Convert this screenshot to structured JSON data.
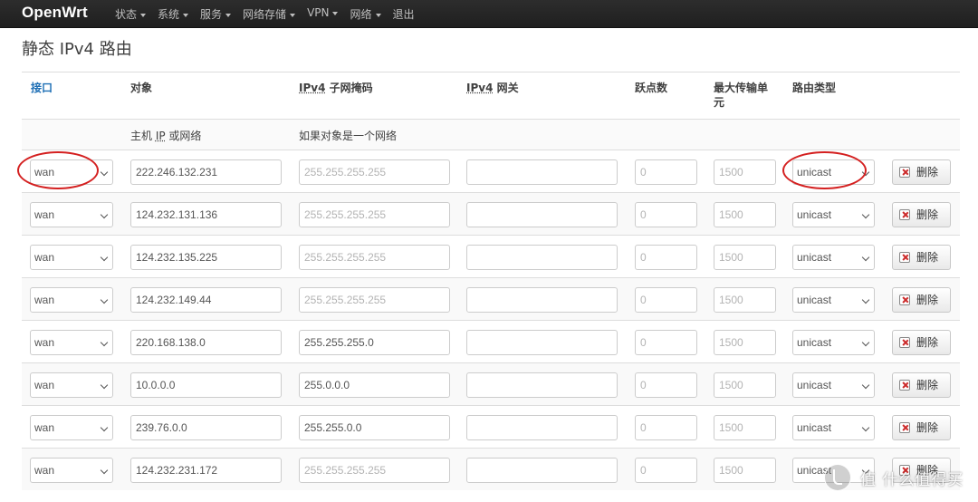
{
  "navbar": {
    "brand": "OpenWrt",
    "menu": [
      {
        "label": "状态",
        "dropdown": true
      },
      {
        "label": "系统",
        "dropdown": true
      },
      {
        "label": "服务",
        "dropdown": true
      },
      {
        "label": "网络存储",
        "dropdown": true
      },
      {
        "label": "VPN",
        "dropdown": true
      },
      {
        "label": "网络",
        "dropdown": true
      },
      {
        "label": "退出",
        "dropdown": false
      }
    ]
  },
  "page": {
    "title": "静态 IPv4 路由"
  },
  "table": {
    "headers": {
      "interface": "接口",
      "target": "对象",
      "netmask_abbr": "IPv4",
      "netmask_rest": " 子网掩码",
      "gateway_abbr": "IPv4",
      "gateway_rest": " 网关",
      "metric": "跃点数",
      "mtu": "最大传输单元",
      "type": "路由类型"
    },
    "descriptions": {
      "target_pre": "主机 ",
      "target_abbr": "IP",
      "target_post": " 或网络",
      "netmask": "如果对象是一个网络"
    },
    "placeholders": {
      "netmask": "255.255.255.255",
      "gateway": "",
      "metric": "0",
      "mtu": "1500"
    },
    "delete_label": "删除",
    "rows": [
      {
        "interface": "wan",
        "target": "222.246.132.231",
        "netmask": "",
        "gateway": "",
        "type": "unicast"
      },
      {
        "interface": "wan",
        "target": "124.232.131.136",
        "netmask": "",
        "gateway": "",
        "type": "unicast"
      },
      {
        "interface": "wan",
        "target": "124.232.135.225",
        "netmask": "",
        "gateway": "",
        "type": "unicast"
      },
      {
        "interface": "wan",
        "target": "124.232.149.44",
        "netmask": "",
        "gateway": "",
        "type": "unicast"
      },
      {
        "interface": "wan",
        "target": "220.168.138.0",
        "netmask": "255.255.255.0",
        "gateway": "",
        "type": "unicast"
      },
      {
        "interface": "wan",
        "target": "10.0.0.0",
        "netmask": "255.0.0.0",
        "gateway": "",
        "type": "unicast"
      },
      {
        "interface": "wan",
        "target": "239.76.0.0",
        "netmask": "255.255.0.0",
        "gateway": "",
        "type": "unicast"
      },
      {
        "interface": "wan",
        "target": "124.232.231.172",
        "netmask": "",
        "gateway": "",
        "type": "unicast"
      }
    ]
  },
  "annotation": {
    "color": "#d42020"
  },
  "watermark": {
    "text": "值 什么值得买"
  }
}
